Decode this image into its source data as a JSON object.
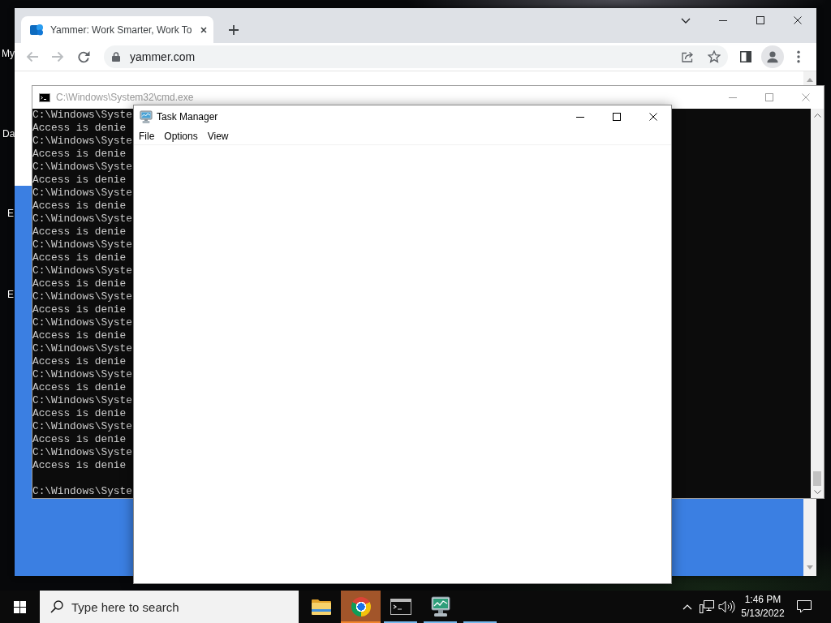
{
  "desktop": {
    "icon_labels": [
      "My",
      "Da",
      "E",
      "E"
    ]
  },
  "browser": {
    "tabs": [
      {
        "title": "Yammer: Work Smarter, Work To",
        "selected": true
      }
    ],
    "back": {
      "disabled": true
    },
    "forward": {
      "disabled": true
    },
    "address": "yammer.com"
  },
  "console_window": {
    "title": "C:\\Windows\\System32\\cmd.exe",
    "active": false,
    "output": [
      "C:\\Windows\\Syste",
      "Access is denie",
      "C:\\Windows\\Syste",
      "Access is denie",
      "C:\\Windows\\Syste",
      "Access is denie",
      "C:\\Windows\\Syste",
      "Access is denie",
      "C:\\Windows\\Syste",
      "Access is denie",
      "C:\\Windows\\Syste",
      "Access is denie",
      "C:\\Windows\\Syste",
      "Access is denie",
      "C:\\Windows\\Syste",
      "Access is denie",
      "C:\\Windows\\Syste",
      "Access is denie",
      "C:\\Windows\\Syste",
      "Access is denie",
      "C:\\Windows\\Syste",
      "Access is denie",
      "C:\\Windows\\Syste",
      "Access is denie",
      "C:\\Windows\\Syste",
      "Access is denie",
      "C:\\Windows\\Syste",
      "Access is denie"
    ],
    "prompt": "C:\\Windows\\Syste"
  },
  "task_manager": {
    "title": "Task Manager",
    "active": true,
    "menu": [
      "File",
      "Options",
      "View"
    ]
  },
  "taskbar": {
    "search": {
      "placeholder": "Type here to search"
    },
    "apps": [
      {
        "kind": "folder",
        "running": false,
        "selected": false
      },
      {
        "kind": "browser",
        "running": true,
        "selected": true
      },
      {
        "kind": "console",
        "running": true,
        "selected": false
      },
      {
        "kind": "monitor",
        "running": true,
        "selected": false
      },
      {
        "kind": "blank",
        "running": true,
        "selected": false
      }
    ],
    "clock": {
      "time": "1:46 PM",
      "date": "5/13/2022"
    }
  }
}
